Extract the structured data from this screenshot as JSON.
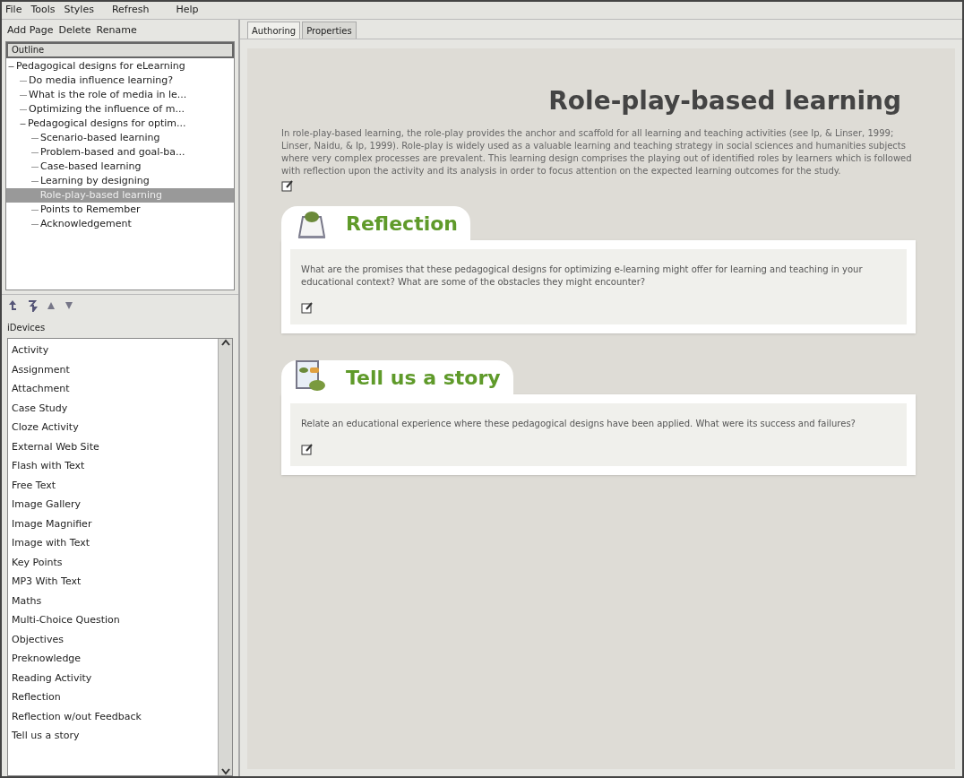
{
  "menu": [
    "File",
    "Tools",
    "Styles",
    "Refresh",
    "Help"
  ],
  "outline_toolbar": [
    "Add Page",
    "Delete",
    "Rename"
  ],
  "outline": {
    "title": "Outline",
    "items": [
      {
        "label": "Pedagogical designs for eLearning",
        "expanded": true,
        "selected": false,
        "children": [
          {
            "label": "Do media influence learning?",
            "selected": false
          },
          {
            "label": "What is the role of media in le...",
            "selected": false
          },
          {
            "label": "Optimizing the influence of m...",
            "selected": false
          },
          {
            "label": "Pedagogical designs for optim...",
            "expanded": true,
            "selected": false,
            "children": [
              {
                "label": "Scenario-based learning",
                "selected": false
              },
              {
                "label": "Problem-based and goal-ba...",
                "selected": false
              },
              {
                "label": "Case-based learning",
                "selected": false
              },
              {
                "label": "Learning by designing",
                "selected": false
              },
              {
                "label": "Role-play-based learning",
                "selected": true
              },
              {
                "label": "Points to Remember",
                "selected": false
              },
              {
                "label": "Acknowledgement",
                "selected": false
              }
            ]
          }
        ]
      }
    ]
  },
  "idevices": {
    "title": "iDevices",
    "items": [
      "Activity",
      "Assignment",
      "Attachment",
      "Case Study",
      "Cloze Activity",
      "External Web Site",
      "Flash with Text",
      "Free Text",
      "Image Gallery",
      "Image Magnifier",
      "Image with Text",
      "Key Points",
      "MP3 With Text",
      "Maths",
      "Multi-Choice Question",
      "Objectives",
      "Preknowledge",
      "Reading Activity",
      "Reflection",
      "Reflection w/out Feedback",
      "Tell us a story"
    ]
  },
  "tabs": [
    {
      "label": "Authoring",
      "selected": true
    },
    {
      "label": "Properties",
      "selected": false
    }
  ],
  "page": {
    "title": "Role-play-based learning",
    "intro": "In role-play-based learning, the role-play provides the anchor and scaffold for all learning and teaching activities (see Ip, & Linser, 1999; Linser, Naidu, & Ip, 1999). Role-play is widely used as a valuable learning and teaching strategy in social sciences and humanities subjects where very complex processes are prevalent. This learning design comprises the playing out of identified roles by learners which is followed with reflection upon the activity and its analysis in order to focus attention on the expected learning outcomes for the study.",
    "blocks": [
      {
        "kind": "reflection",
        "title": "Reflection",
        "text": "What are the promises that these pedagogical designs for optimizing e-learning might offer for learning and teaching in your educational context? What are some of the obstacles they might encounter?"
      },
      {
        "kind": "story",
        "title": "Tell us a story",
        "text": "Relate an educational experience where these pedagogical designs have been applied. What were its success and failures?"
      }
    ]
  }
}
